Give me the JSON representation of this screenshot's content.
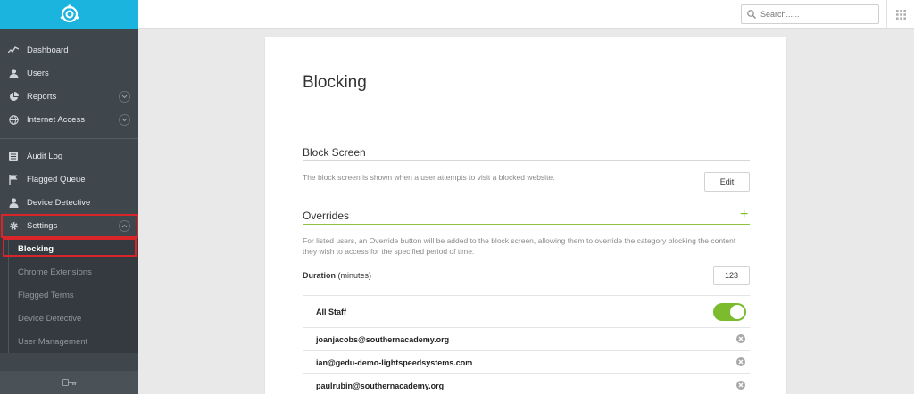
{
  "sidebar": {
    "logo_icon": "lightspeed-logo-icon",
    "nav": [
      {
        "label": "Dashboard",
        "icon": "chart-line-icon"
      },
      {
        "label": "Users",
        "icon": "user-icon"
      },
      {
        "label": "Reports",
        "icon": "pie-chart-icon"
      },
      {
        "label": "Internet Access",
        "icon": "globe-icon"
      },
      {
        "label": "Audit Log",
        "icon": "list-icon"
      },
      {
        "label": "Flagged Queue",
        "icon": "flag-icon"
      },
      {
        "label": "Device Detective",
        "icon": "user-icon"
      },
      {
        "label": "Settings",
        "icon": "gear-icon"
      }
    ],
    "sub": [
      {
        "label": "Blocking"
      },
      {
        "label": "Chrome Extensions"
      },
      {
        "label": "Flagged Terms"
      },
      {
        "label": "Device Detective"
      },
      {
        "label": "User Management"
      }
    ]
  },
  "topbar": {
    "search_placeholder": "Search......"
  },
  "main": {
    "title": "Blocking",
    "block_screen": {
      "heading": "Block Screen",
      "description": "The block screen is shown when a user attempts to visit a blocked website.",
      "edit_label": "Edit"
    },
    "overrides": {
      "heading": "Overrides",
      "add_symbol": "+",
      "description": "For listed users, an Override button will be added to the block screen, allowing them to override the category blocking the content they wish to access for the specified period of time.",
      "duration_label": "Duration",
      "duration_unit": "(minutes)",
      "duration_value": "123",
      "all_staff_label": "All Staff",
      "all_staff_enabled": true,
      "users": [
        "joanjacobs@southernacademy.org",
        "ian@gedu-demo-lightspeedsystems.com",
        "paulrubin@southernacademy.org"
      ]
    }
  },
  "colors": {
    "accent": "#1ab4df",
    "sidebar": "#3f464c",
    "green": "#7cbb2d",
    "highlight": "#d9242a"
  }
}
